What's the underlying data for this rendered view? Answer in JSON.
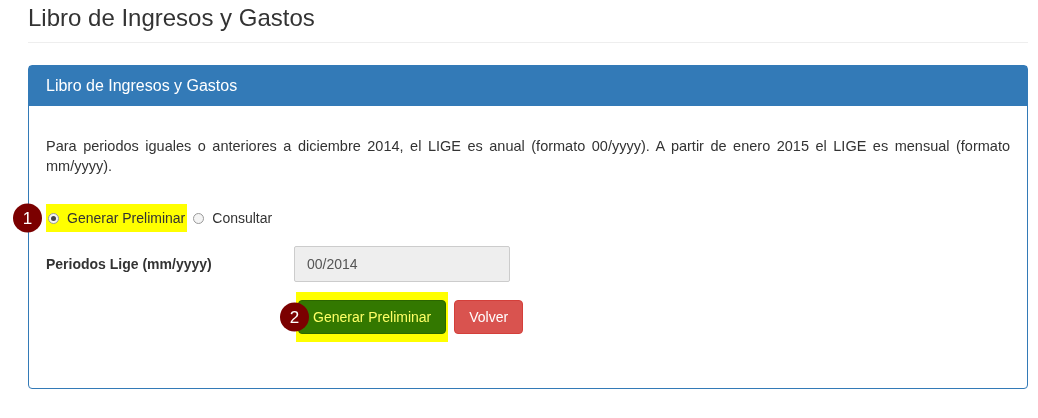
{
  "page_title": "Libro de Ingresos y Gastos",
  "panel": {
    "title": "Libro de Ingresos y Gastos",
    "description": "Para periodos iguales o anteriores a diciembre 2014, el LIGE es anual (formato 00/yyyy). A partir de enero 2015 el LIGE es mensual (formato mm/yyyy).",
    "radios": [
      {
        "label": "Generar Preliminar",
        "selected": true,
        "highlighted": true,
        "marker": "1"
      },
      {
        "label": "Consultar",
        "selected": false,
        "highlighted": false
      }
    ],
    "field": {
      "label": "Periodos Lige (mm/yyyy)",
      "value": "00/2014",
      "disabled": true
    },
    "buttons": [
      {
        "label": "Generar Preliminar",
        "kind": "success",
        "highlighted": true,
        "marker": "2"
      },
      {
        "label": "Volver",
        "kind": "danger",
        "highlighted": false
      }
    ]
  }
}
